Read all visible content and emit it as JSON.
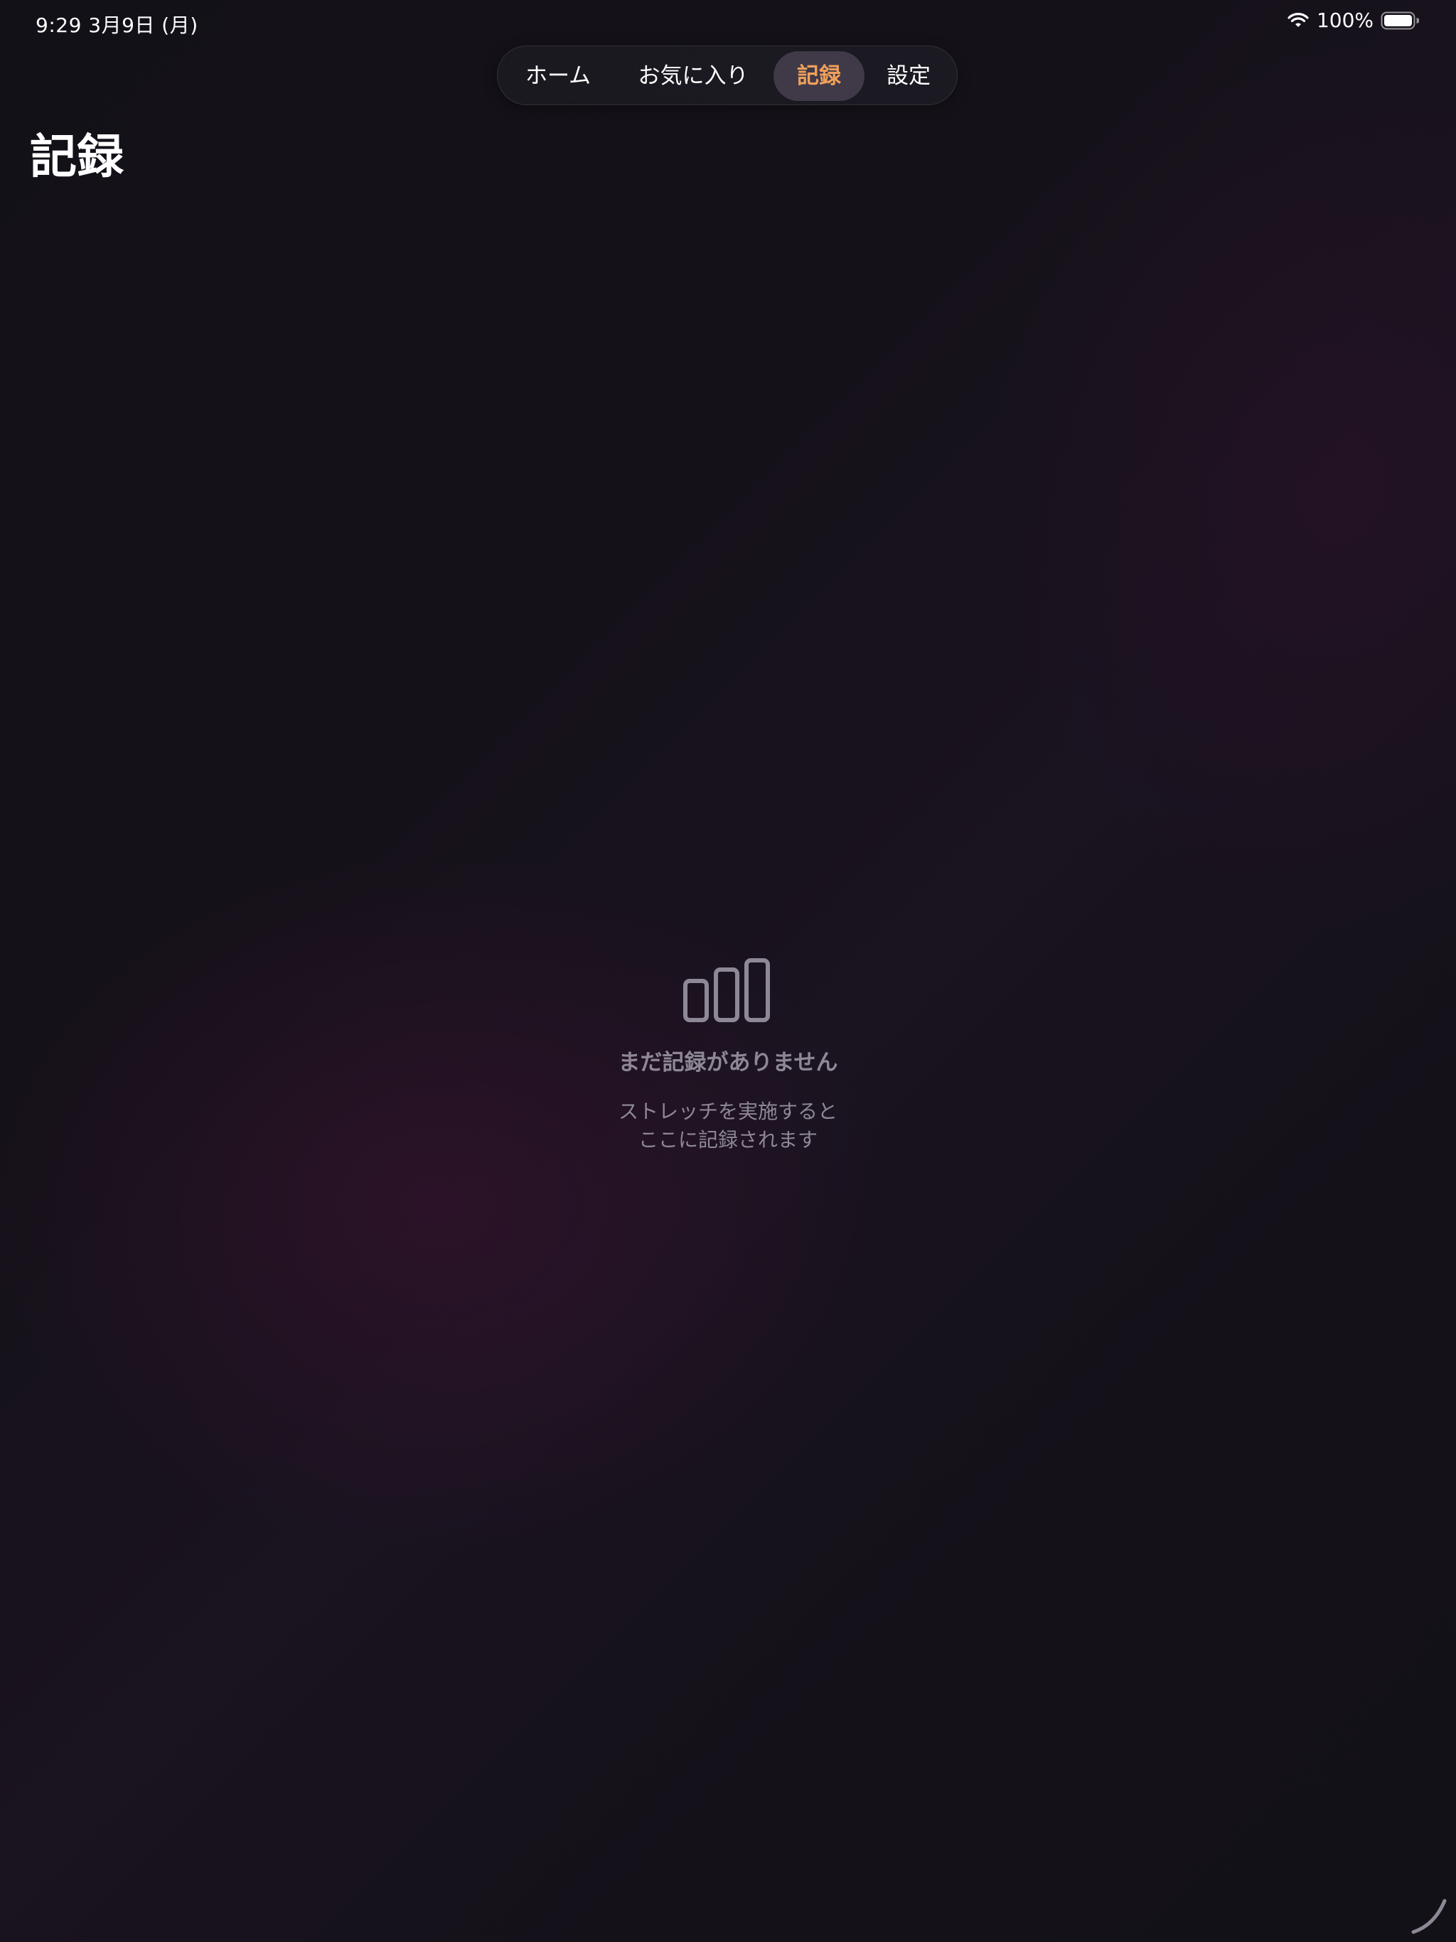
{
  "status_bar": {
    "time_date": "9:29   3月9日 (月)",
    "battery_percent": "100%",
    "icons": [
      "wifi-icon",
      "battery-icon"
    ]
  },
  "tabs": [
    {
      "label": "ホーム",
      "selected": false
    },
    {
      "label": "お気に入り",
      "selected": false
    },
    {
      "label": "記録",
      "selected": true
    },
    {
      "label": "設定",
      "selected": false
    }
  ],
  "page": {
    "title": "記録"
  },
  "empty_state": {
    "icon": "bar-chart-icon",
    "title": "まだ記録がありません",
    "description_line1": "ストレッチを実施すると",
    "description_line2": "ここに記録されます"
  },
  "colors": {
    "accent": "#f0a05a",
    "muted_text": "#8e8896",
    "background": "#13111a"
  }
}
